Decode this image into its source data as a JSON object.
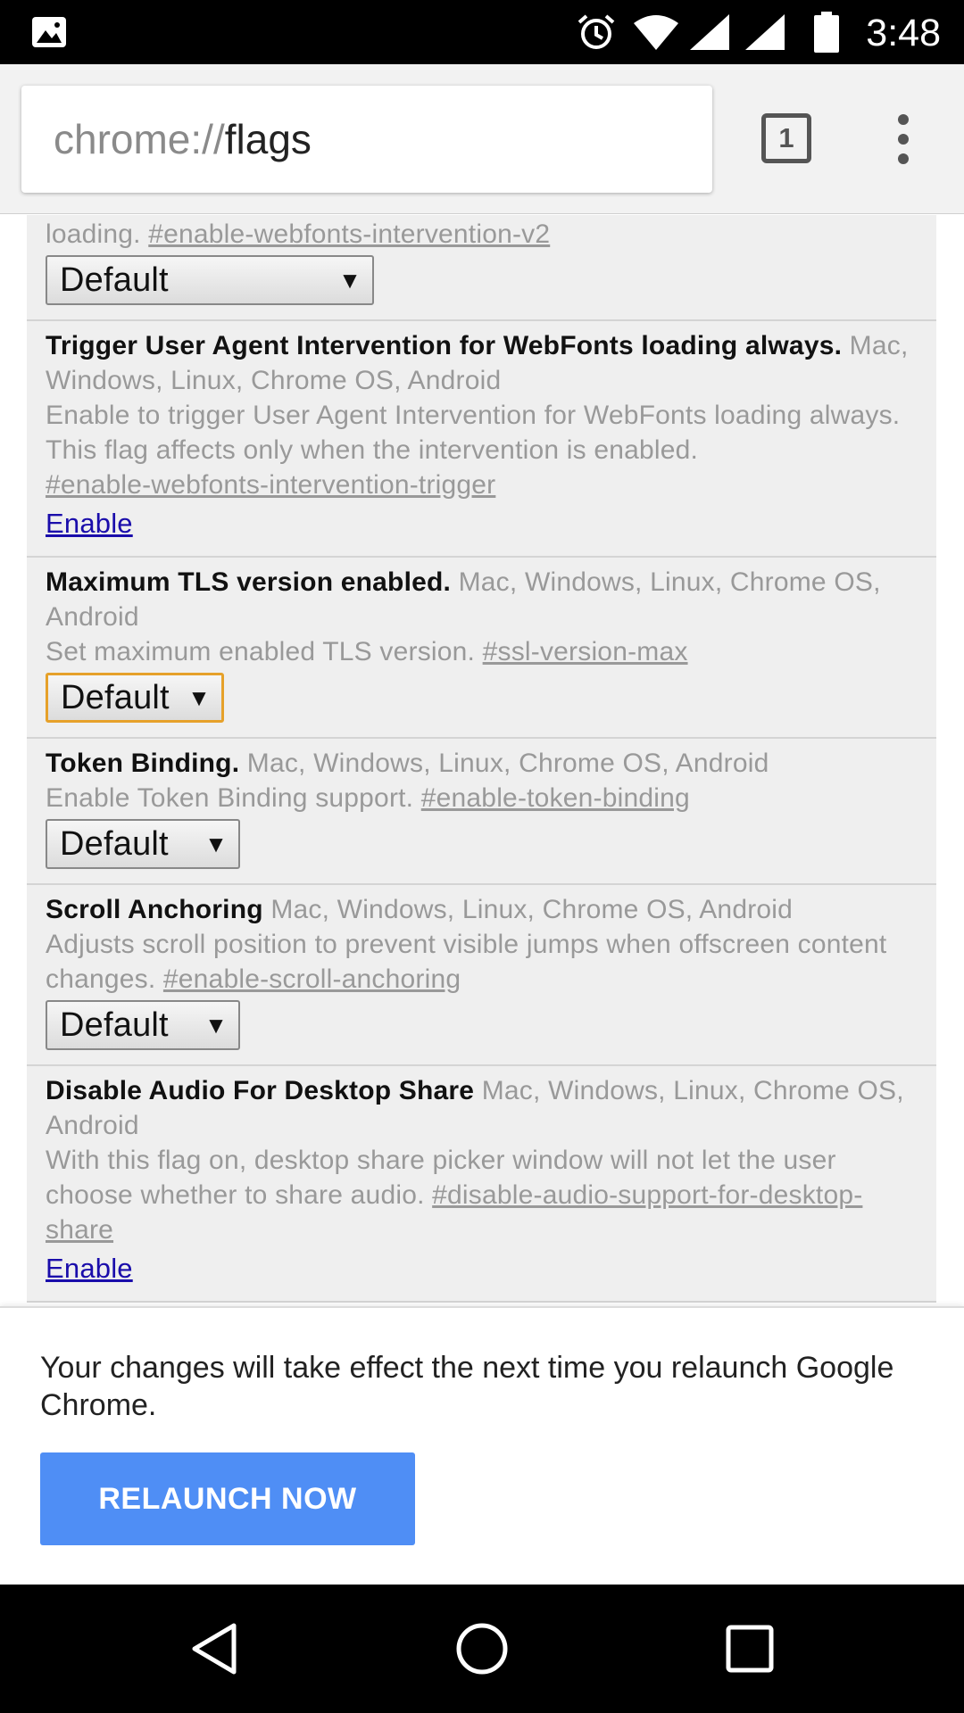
{
  "status_bar": {
    "time": "3:48",
    "icons": [
      "image-icon",
      "alarm-icon",
      "wifi-icon",
      "signal-icon",
      "signal-icon",
      "battery-icon"
    ]
  },
  "toolbar": {
    "url_scheme": "chrome://",
    "url_host": "flags",
    "tab_count": "1"
  },
  "flags": [
    {
      "title": "",
      "platforms": "",
      "description": "loading.",
      "anchor": "#enable-webfonts-intervention-v2",
      "control": "select",
      "value": "Default"
    },
    {
      "title": "Trigger User Agent Intervention for WebFonts loading always.",
      "platforms": "Mac, Windows, Linux, Chrome OS, Android",
      "description": "Enable to trigger User Agent Intervention for WebFonts loading always. This flag affects only when the intervention is enabled.",
      "anchor": "#enable-webfonts-intervention-trigger",
      "control": "link",
      "value": "Enable"
    },
    {
      "title": "Maximum TLS version enabled.",
      "platforms": "Mac, Windows, Linux, Chrome OS, Android",
      "description": "Set maximum enabled TLS version.",
      "anchor": "#ssl-version-max",
      "control": "select",
      "value": "Default"
    },
    {
      "title": "Token Binding.",
      "platforms": "Mac, Windows, Linux, Chrome OS, Android",
      "description": "Enable Token Binding support.",
      "anchor": "#enable-token-binding",
      "control": "select",
      "value": "Default"
    },
    {
      "title": "Scroll Anchoring",
      "platforms": "Mac, Windows, Linux, Chrome OS, Android",
      "description": "Adjusts scroll position to prevent visible jumps when offscreen content changes.",
      "anchor": "#enable-scroll-anchoring",
      "control": "select",
      "value": "Default"
    },
    {
      "title": "Disable Audio For Desktop Share",
      "platforms": "Mac, Windows, Linux, Chrome OS, Android",
      "description": "With this flag on, desktop share picker window will not let the user choose whether to share audio.",
      "anchor": "#disable-audio-support-for-desktop-share",
      "control": "link",
      "value": "Enable"
    }
  ],
  "infobar": {
    "message": "Your changes will take effect the next time you relaunch Google Chrome.",
    "button_label": "RELAUNCH NOW"
  },
  "nav_bar": {
    "buttons": [
      "back-icon",
      "home-icon",
      "recents-icon"
    ]
  },
  "colors": {
    "accent_button": "#4f8ef5",
    "link": "#1a0dab",
    "focus_outline": "#e6a12a"
  }
}
